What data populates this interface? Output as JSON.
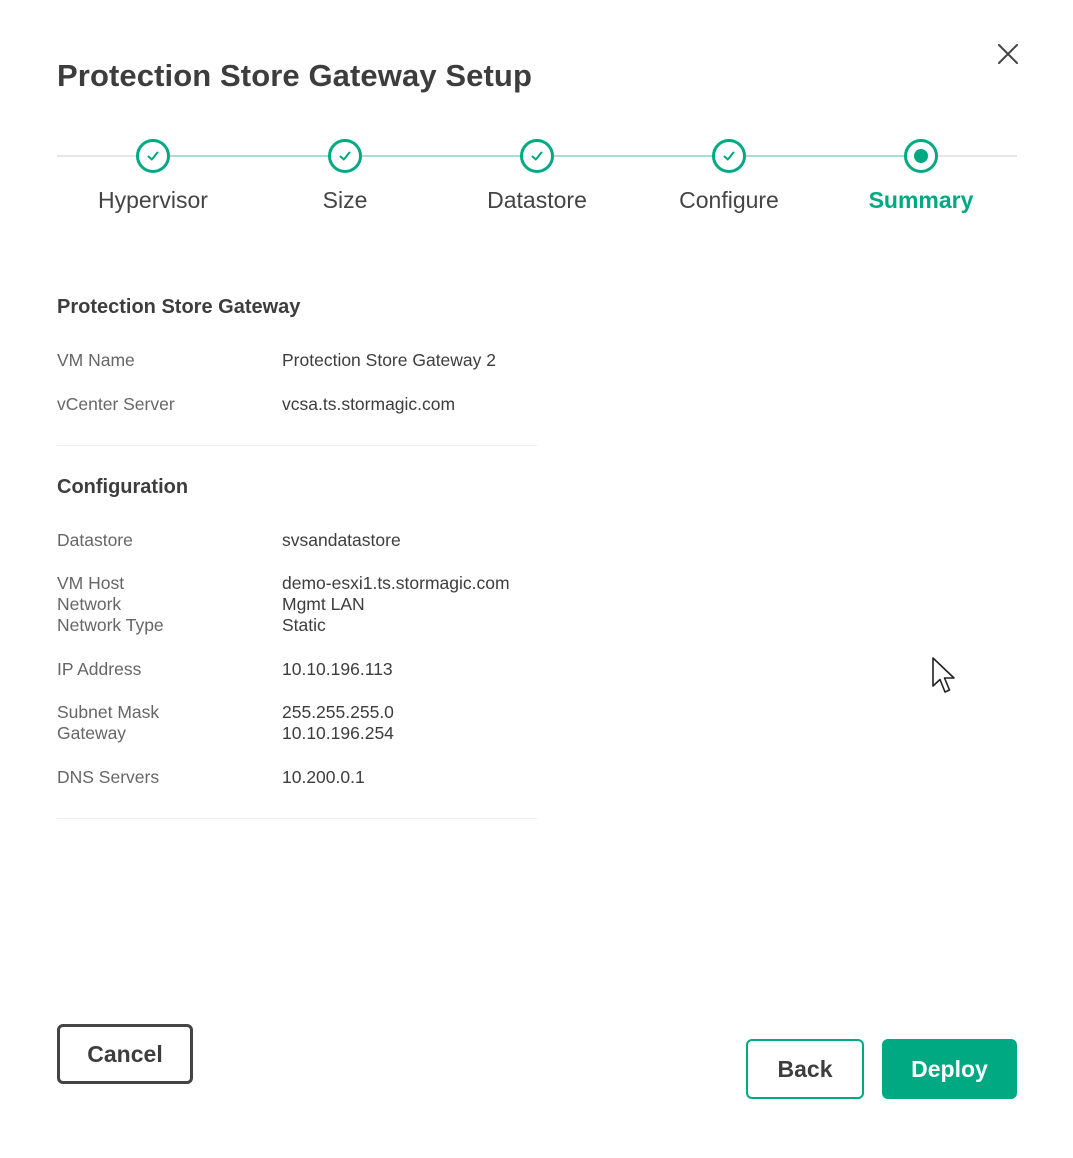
{
  "dialog": {
    "title": "Protection Store Gateway Setup"
  },
  "stepper": {
    "steps": [
      {
        "label": "Hypervisor",
        "state": "complete"
      },
      {
        "label": "Size",
        "state": "complete"
      },
      {
        "label": "Datastore",
        "state": "complete"
      },
      {
        "label": "Configure",
        "state": "complete"
      },
      {
        "label": "Summary",
        "state": "current"
      }
    ]
  },
  "summary": {
    "gateway": {
      "heading": "Protection Store Gateway",
      "rows": [
        {
          "key": "VM Name",
          "value": "Protection Store Gateway 2"
        },
        {
          "key": "vCenter Server",
          "value": "vcsa.ts.stormagic.com"
        }
      ]
    },
    "configuration": {
      "heading": "Configuration",
      "rows": [
        {
          "key": "Datastore",
          "value": "svsandatastore"
        },
        {
          "key": "VM Host",
          "value": "demo-esxi1.ts.stormagic.com"
        },
        {
          "key": "Network",
          "value": "Mgmt LAN"
        },
        {
          "key": "Network Type",
          "value": "Static"
        },
        {
          "key": "IP Address",
          "value": "10.10.196.113"
        },
        {
          "key": "Subnet Mask",
          "value": "255.255.255.0"
        },
        {
          "key": "Gateway",
          "value": "10.10.196.254"
        },
        {
          "key": "DNS Servers",
          "value": "10.200.0.1"
        }
      ]
    }
  },
  "footer": {
    "cancel_label": "Cancel",
    "back_label": "Back",
    "deploy_label": "Deploy"
  },
  "colors": {
    "accent": "#01a982",
    "text": "#444444",
    "muted": "#666666"
  },
  "icons": {
    "close": "close-icon",
    "complete": "checkmark-icon",
    "current": "dot-icon",
    "pointer": "mouse-cursor-icon"
  }
}
